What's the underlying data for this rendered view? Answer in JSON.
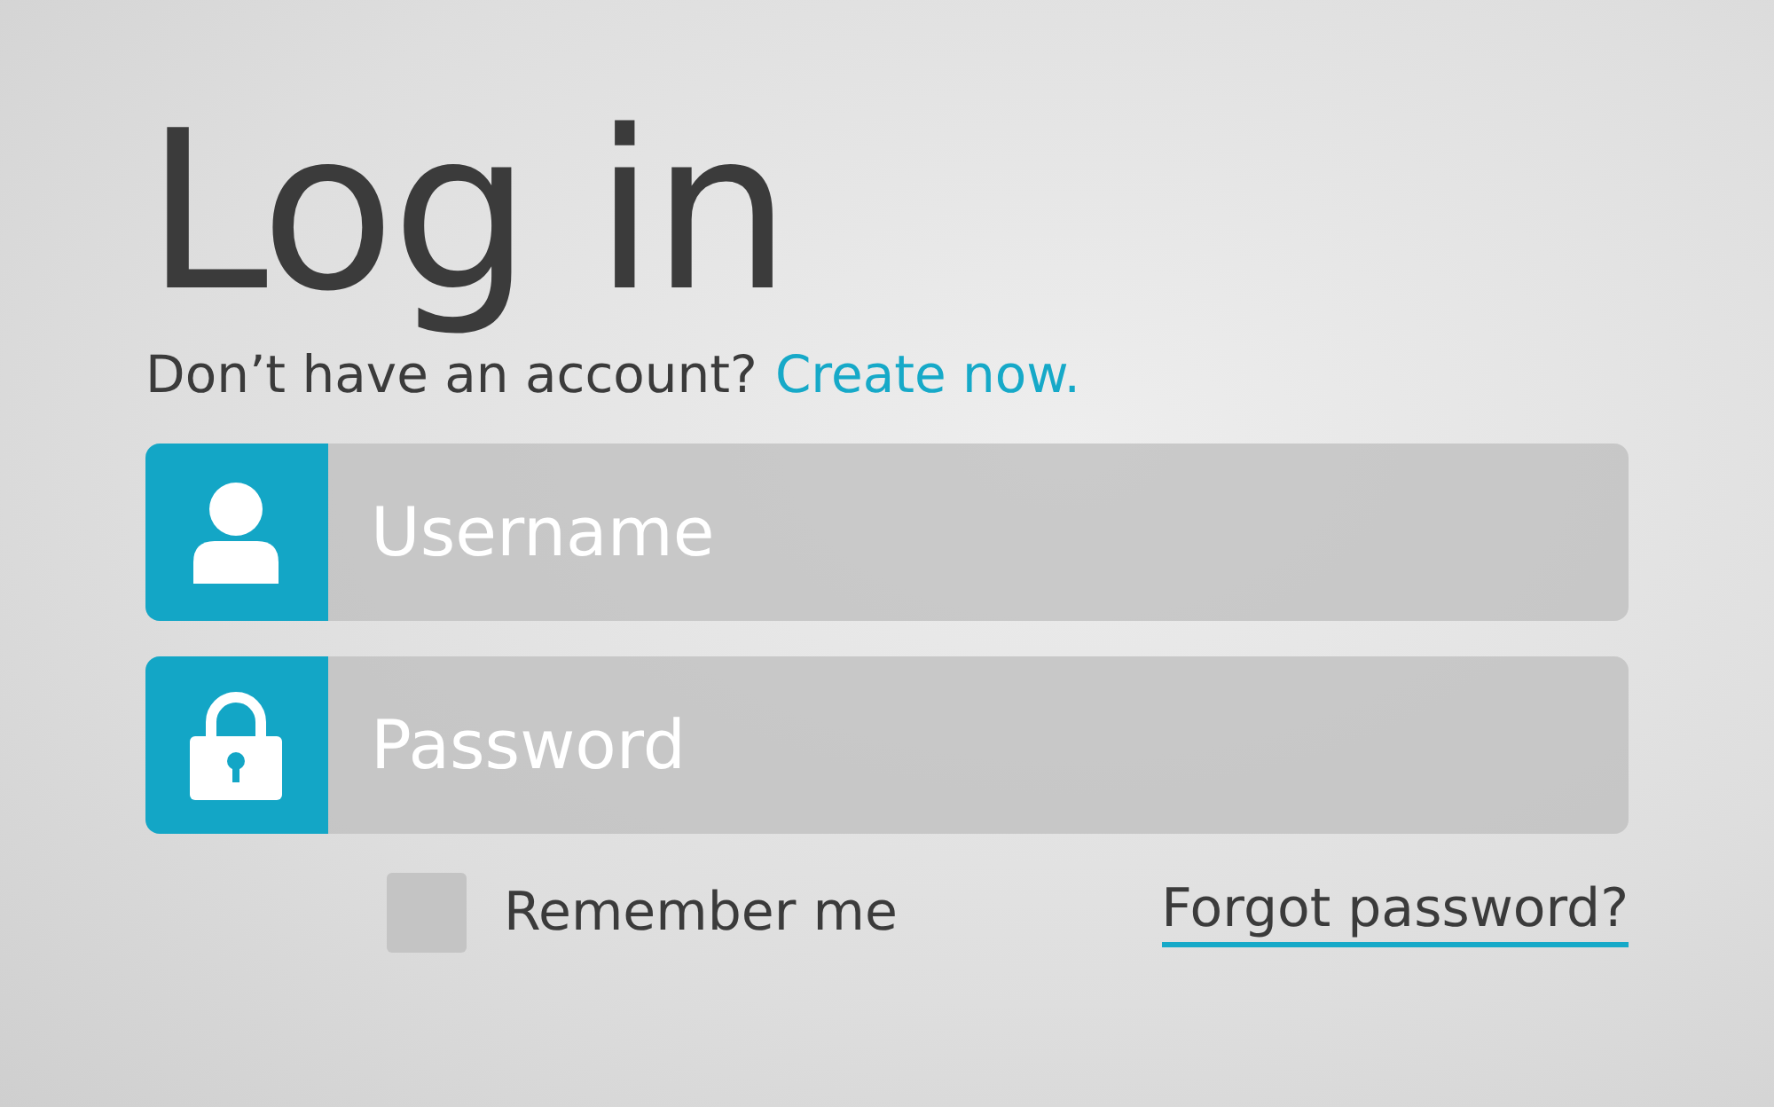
{
  "title": "Log in",
  "signup_prompt": {
    "text": "Don’t have an account?",
    "link": "Create now."
  },
  "fields": [
    {
      "kind": "user",
      "placeholder": "Username"
    },
    {
      "kind": "lock",
      "placeholder": "Password"
    }
  ],
  "remember": {
    "label": "Remember me",
    "checked": false
  },
  "forgot_link": "Forgot password?"
}
